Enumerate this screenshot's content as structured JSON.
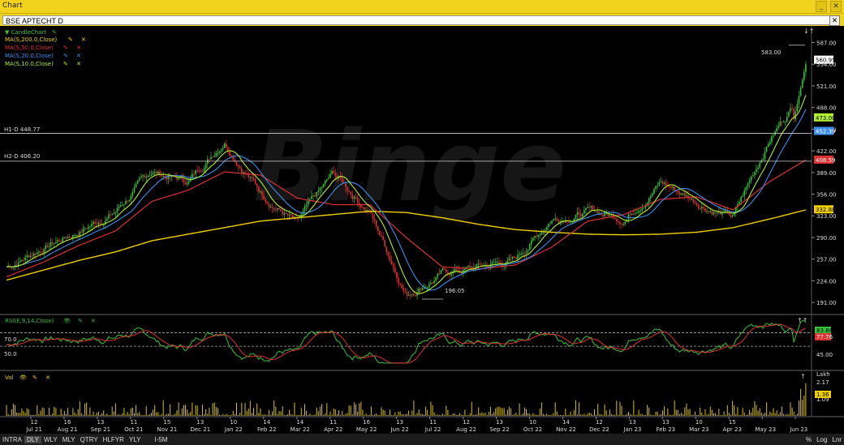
{
  "window": {
    "title": "Chart",
    "symbol": "BSE APTECHT D"
  },
  "legend": [
    {
      "label": "CandleChart",
      "color": "#39c239"
    },
    {
      "label": "MA(S,200.0,Close)",
      "color": "#f0d000"
    },
    {
      "label": "MA(S,50.0,Close)",
      "color": "#e03030"
    },
    {
      "label": "MA(S,20.0,Close)",
      "color": "#3a8ff0"
    },
    {
      "label": "MA(S,10.0,Close)",
      "color": "#b0f030"
    }
  ],
  "watermark": "Binge",
  "hlines": [
    {
      "label": "H1-D 448.77",
      "value": 448.77
    },
    {
      "label": "H2-D 406.20",
      "value": 406.2
    }
  ],
  "annotations": {
    "high": "583.00",
    "low": "196.05"
  },
  "price_axis": {
    "ticks": [
      "587.00",
      "554.00",
      "521.00",
      "488.00",
      "455.00",
      "422.00",
      "389.00",
      "356.00",
      "323.00",
      "290.00",
      "257.00",
      "224.00",
      "191.00"
    ],
    "badges": [
      {
        "text": "560.95",
        "value": 560.95,
        "bg": "#ffffff",
        "fg": "#000000"
      },
      {
        "text": "473.00",
        "value": 473,
        "bg": "#b0f030",
        "fg": "#000000"
      },
      {
        "text": "452.39",
        "value": 452.39,
        "bg": "#3a8ff0",
        "fg": "#ffffff"
      },
      {
        "text": "408.59",
        "value": 408.59,
        "bg": "#e03030",
        "fg": "#ffffff"
      },
      {
        "text": "332.88",
        "value": 332.88,
        "bg": "#f0d000",
        "fg": "#000000"
      }
    ]
  },
  "rsi": {
    "label": "RSI(E,9,14,Close)",
    "levels": [
      {
        "label": "70.0",
        "value": 70
      },
      {
        "label": "50.0",
        "value": 50
      }
    ],
    "tick": "45.00",
    "badges": [
      {
        "text": "83.88",
        "bg": "#39c239"
      },
      {
        "text": "77.76",
        "bg": "#e03030"
      }
    ]
  },
  "volume": {
    "label": "Vol",
    "unit": "Lakh",
    "ticks": [
      "2.17",
      "1.09"
    ],
    "badge": "1.36"
  },
  "x_axis": {
    "days": [
      "12",
      "16",
      "13",
      "11",
      "15",
      "13",
      "10",
      "14",
      "14",
      "11",
      "16",
      "13",
      "11",
      "12",
      "13",
      "10",
      "14",
      "12",
      "13",
      "13",
      "10",
      "15"
    ],
    "months": [
      "Jul 21",
      "Aug 21",
      "Sep 21",
      "Oct 21",
      "Nov 21",
      "Dec 21",
      "Jan 22",
      "Feb 22",
      "Mar 22",
      "Apr 22",
      "May 22",
      "Jun 22",
      "Jul 22",
      "Aug 22",
      "Sep 22",
      "Oct 22",
      "Nov 22",
      "Dec 22",
      "Jan 23",
      "Feb 23",
      "Mar 23",
      "Apr 23",
      "May 23",
      "Jun 23"
    ]
  },
  "chart_data": {
    "type": "line",
    "title": "BSE APTECHT D",
    "x": [
      "Jul 21",
      "Aug 21",
      "Sep 21",
      "Oct 21",
      "Nov 21",
      "Dec 21",
      "Jan 22",
      "Feb 22",
      "Mar 22",
      "Apr 22",
      "May 22",
      "Jun 22",
      "Jul 22",
      "Aug 22",
      "Sep 22",
      "Oct 22",
      "Nov 22",
      "Dec 22",
      "Jan 23",
      "Feb 23",
      "Mar 23",
      "Apr 23",
      "May 23"
    ],
    "series": [
      {
        "name": "Close",
        "values": [
          245,
          275,
          300,
          330,
          390,
          375,
          440,
          360,
          310,
          385,
          330,
          205,
          235,
          245,
          255,
          320,
          330,
          320,
          375,
          345,
          320,
          440,
          520
        ]
      },
      {
        "name": "MA(S,200.0,Close)",
        "values": [
          225,
          240,
          255,
          268,
          285,
          295,
          305,
          315,
          320,
          325,
          330,
          328,
          320,
          310,
          302,
          298,
          295,
          294,
          295,
          298,
          305,
          318,
          332
        ]
      },
      {
        "name": "MA(S,50.0,Close)",
        "values": [
          230,
          252,
          278,
          300,
          345,
          362,
          390,
          385,
          350,
          340,
          340,
          290,
          245,
          242,
          248,
          275,
          315,
          325,
          348,
          352,
          332,
          375,
          408
        ]
      }
    ],
    "ylim": [
      180,
      600
    ],
    "ylabel": ""
  },
  "bottom": {
    "tabs": [
      "INTRA",
      "DLY",
      "WLY",
      "MLY",
      "QTRY",
      "HLFYR",
      "YLY",
      "I-5M"
    ],
    "selected": "DLY",
    "right": [
      "%",
      "Log",
      "Lnr"
    ]
  }
}
